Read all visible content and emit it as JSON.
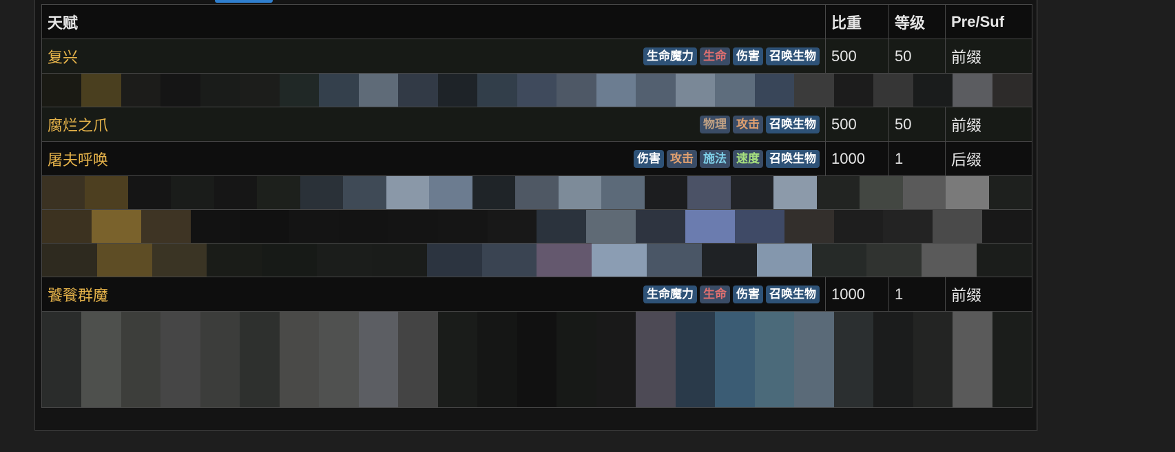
{
  "table": {
    "headers": [
      "天赋",
      "比重",
      "等级",
      "Pre/Suf"
    ],
    "rows": [
      {
        "name": "复兴",
        "tags": [
          "生命魔力",
          "生命",
          "伤害",
          "召唤生物"
        ],
        "weight": "500",
        "level": "50",
        "affix": "前缀"
      },
      {
        "name": "腐烂之爪",
        "tags": [
          "物理",
          "攻击",
          "召唤生物"
        ],
        "weight": "500",
        "level": "50",
        "affix": "前缀"
      },
      {
        "name": "屠夫呼唤",
        "tags": [
          "伤害",
          "攻击",
          "施法",
          "速度",
          "召唤生物"
        ],
        "weight": "1000",
        "level": "1",
        "affix": "后缀"
      },
      {
        "name": "饕餮群魔",
        "tags": [
          "生命魔力",
          "生命",
          "伤害",
          "召唤生物"
        ],
        "weight": "1000",
        "level": "1",
        "affix": "前缀"
      }
    ]
  },
  "colors": {
    "accent_tab": "#2f7fcf",
    "talent_name": "#e6b34a",
    "tag_bg": "#2e5277"
  }
}
